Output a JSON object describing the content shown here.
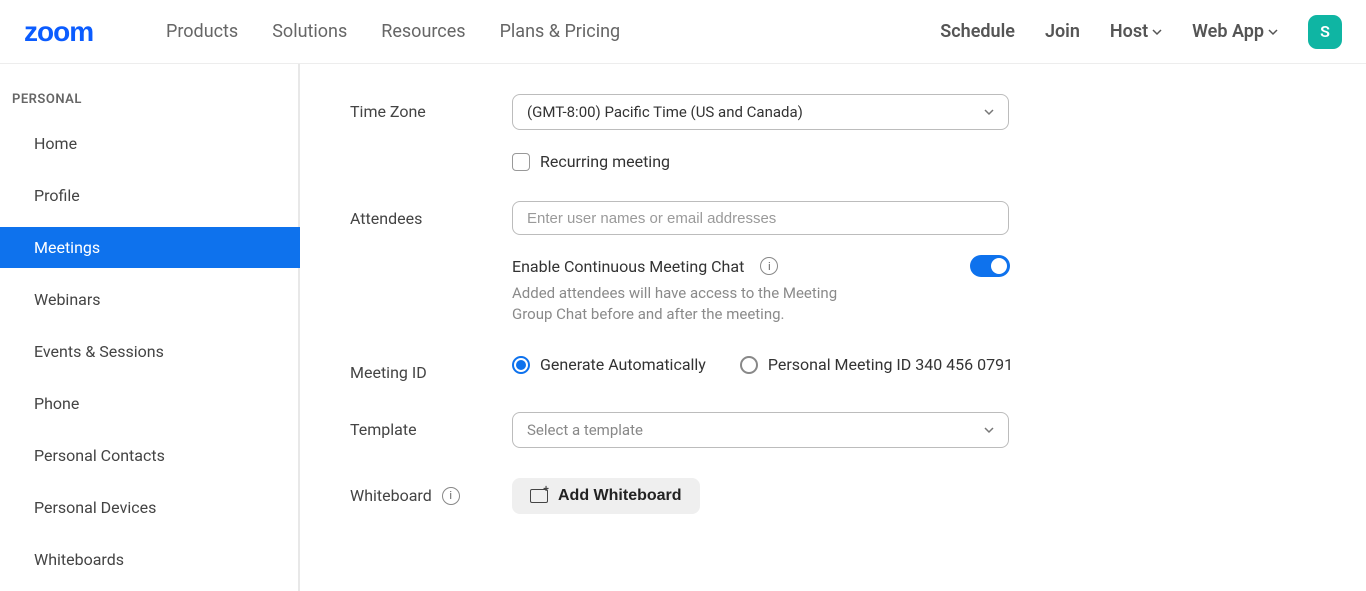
{
  "nav": {
    "primary": [
      "Products",
      "Solutions",
      "Resources",
      "Plans & Pricing"
    ],
    "secondary": {
      "schedule": "Schedule",
      "join": "Join",
      "host": "Host",
      "webapp": "Web App"
    },
    "avatar_letter": "S"
  },
  "sidebar": {
    "section": "PERSONAL",
    "items": [
      "Home",
      "Profile",
      "Meetings",
      "Webinars",
      "Events & Sessions",
      "Phone",
      "Personal Contacts",
      "Personal Devices",
      "Whiteboards"
    ],
    "active_index": 2
  },
  "form": {
    "timezone": {
      "label": "Time Zone",
      "value": "(GMT-8:00) Pacific Time (US and Canada)"
    },
    "recurring": {
      "label": "Recurring meeting",
      "checked": false
    },
    "attendees": {
      "label": "Attendees",
      "placeholder": "Enter user names or email addresses"
    },
    "chat": {
      "label": "Enable Continuous Meeting Chat",
      "hint": "Added attendees will have access to the Meeting Group Chat before and after the meeting.",
      "enabled": true
    },
    "meeting_id": {
      "label": "Meeting ID",
      "opt_auto": "Generate Automatically",
      "opt_personal": "Personal Meeting ID 340 456 0791",
      "selected": "auto"
    },
    "template": {
      "label": "Template",
      "placeholder": "Select a template"
    },
    "whiteboard": {
      "label": "Whiteboard",
      "button": "Add Whiteboard"
    }
  }
}
